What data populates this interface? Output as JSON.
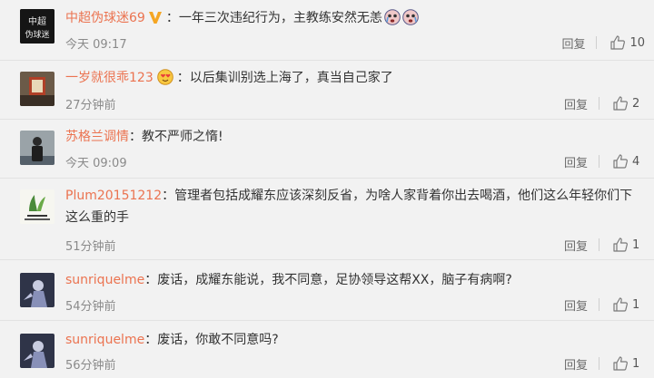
{
  "comments": [
    {
      "username": "中超伪球迷69",
      "text": "一年三次违纪行为，主教练安然无恙",
      "time": "今天 09:17",
      "reply_label": "回复",
      "likes": "10",
      "avatar_text": [
        "中超",
        "伪球迷"
      ]
    },
    {
      "username": "一岁就很乖123",
      "text": "以后集训别选上海了，真当自己家了",
      "time": "27分钟前",
      "reply_label": "回复",
      "likes": "2"
    },
    {
      "username": "苏格兰调情",
      "text": "教不严师之惰!",
      "time": "今天 09:09",
      "reply_label": "回复",
      "likes": "4"
    },
    {
      "username": "Plum20151212",
      "text": "管理者包括成耀东应该深刻反省，为啥人家背着你出去喝酒，他们这么年轻你们下这么重的手",
      "time": "51分钟前",
      "reply_label": "回复",
      "likes": "1"
    },
    {
      "username": "sunriquelme",
      "text": "废话，成耀东能说，我不同意，足协领导这帮XX，脑子有病啊?",
      "time": "54分钟前",
      "reply_label": "回复",
      "likes": "1"
    },
    {
      "username": "sunriquelme",
      "text": "废话，你敢不同意吗?",
      "time": "56分钟前",
      "reply_label": "回复",
      "likes": "1"
    }
  ],
  "colors": {
    "username": "#eb7350",
    "badge": "#f5a623",
    "background": "#f2f2f2"
  },
  "icons": {
    "like": "thumbs-up-icon",
    "verified": "v-badge-icon",
    "emoji": "crying-face-icon"
  }
}
